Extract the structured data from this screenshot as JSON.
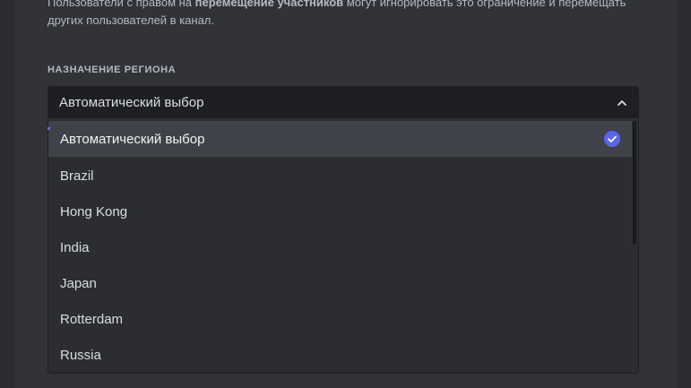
{
  "help": {
    "part1": "Пользователи с правом на ",
    "bold": "перемещение участников",
    "part2": " могут игнорировать это ограничение и перемещать других пользователей в канал."
  },
  "region": {
    "title": "Назначение региона",
    "selected_value": "Автоматический выбор",
    "options": [
      {
        "label": "Автоматический выбор",
        "selected": true
      },
      {
        "label": "Brazil",
        "selected": false
      },
      {
        "label": "Hong Kong",
        "selected": false
      },
      {
        "label": "India",
        "selected": false
      },
      {
        "label": "Japan",
        "selected": false
      },
      {
        "label": "Rotterdam",
        "selected": false
      },
      {
        "label": "Russia",
        "selected": false
      }
    ]
  },
  "colors": {
    "background": "#313338",
    "dropdown": "#2b2d31",
    "input": "#1e1f22",
    "selected_row": "#404249",
    "accent": "#5865f2"
  },
  "icons": {
    "select_toggle": "chevron-up-icon",
    "selected_mark": "check-circle-icon"
  }
}
